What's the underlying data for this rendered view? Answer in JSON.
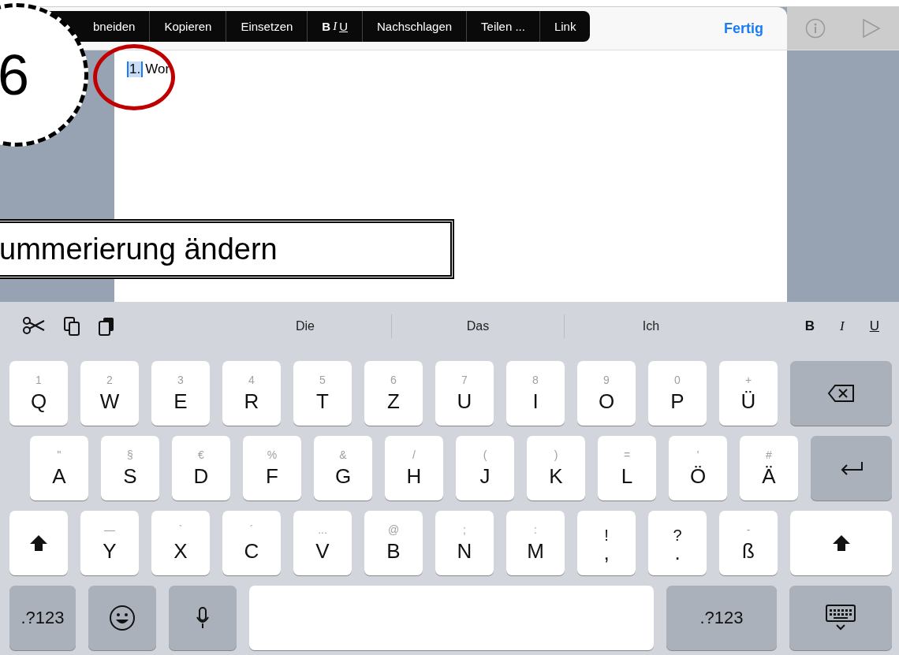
{
  "edit_menu": {
    "items": [
      {
        "kind": "text",
        "label": "bneiden"
      },
      {
        "kind": "text",
        "label": "Kopieren"
      },
      {
        "kind": "text",
        "label": "Einsetzen"
      },
      {
        "kind": "format",
        "letters": [
          "B",
          "I",
          "U"
        ]
      },
      {
        "kind": "text",
        "label": "Nachschlagen"
      },
      {
        "kind": "text",
        "label": "Teilen ..."
      },
      {
        "kind": "text",
        "label": "Link"
      }
    ]
  },
  "toolbar": {
    "done": "Fertig"
  },
  "document": {
    "number": "1.",
    "text": "Wor"
  },
  "annotations": {
    "step": "6",
    "caption": "ummerierung ändern"
  },
  "keyboard": {
    "shortcuts": [
      {
        "kind": "cut"
      },
      {
        "kind": "copy"
      },
      {
        "kind": "paste"
      }
    ],
    "suggestions": [
      "Die",
      "Das",
      "Ich"
    ],
    "format": [
      {
        "kind": "bold",
        "label": "B"
      },
      {
        "kind": "italic",
        "label": "I"
      },
      {
        "kind": "underline",
        "label": "U"
      }
    ],
    "rows": [
      [
        {
          "kind": "char",
          "label": "Q",
          "hint": "1"
        },
        {
          "kind": "char",
          "label": "W",
          "hint": "2"
        },
        {
          "kind": "char",
          "label": "E",
          "hint": "3"
        },
        {
          "kind": "char",
          "label": "R",
          "hint": "4"
        },
        {
          "kind": "char",
          "label": "T",
          "hint": "5"
        },
        {
          "kind": "char",
          "label": "Z",
          "hint": "6"
        },
        {
          "kind": "char",
          "label": "U",
          "hint": "7"
        },
        {
          "kind": "char",
          "label": "I",
          "hint": "8"
        },
        {
          "kind": "char",
          "label": "O",
          "hint": "9"
        },
        {
          "kind": "char",
          "label": "P",
          "hint": "0"
        },
        {
          "kind": "char",
          "label": "Ü",
          "hint": "+"
        },
        {
          "kind": "backspace"
        }
      ],
      [
        {
          "kind": "char",
          "label": "A",
          "hint": "\""
        },
        {
          "kind": "char",
          "label": "S",
          "hint": "§"
        },
        {
          "kind": "char",
          "label": "D",
          "hint": "€"
        },
        {
          "kind": "char",
          "label": "F",
          "hint": "%"
        },
        {
          "kind": "char",
          "label": "G",
          "hint": "&"
        },
        {
          "kind": "char",
          "label": "H",
          "hint": "/"
        },
        {
          "kind": "char",
          "label": "J",
          "hint": "("
        },
        {
          "kind": "char",
          "label": "K",
          "hint": ")"
        },
        {
          "kind": "char",
          "label": "L",
          "hint": "="
        },
        {
          "kind": "char",
          "label": "Ö",
          "hint": "'"
        },
        {
          "kind": "char",
          "label": "Ä",
          "hint": "#"
        },
        {
          "kind": "return"
        }
      ],
      [
        {
          "kind": "shift"
        },
        {
          "kind": "char",
          "label": "Y",
          "hint": "—"
        },
        {
          "kind": "char",
          "label": "X",
          "hint": "`"
        },
        {
          "kind": "char",
          "label": "C",
          "hint": "´"
        },
        {
          "kind": "char",
          "label": "V",
          "hint": "..."
        },
        {
          "kind": "char",
          "label": "B",
          "hint": "@"
        },
        {
          "kind": "char",
          "label": "N",
          "hint": ";"
        },
        {
          "kind": "char",
          "label": "M",
          "hint": ":"
        },
        {
          "kind": "punct",
          "top": "!",
          "label": ","
        },
        {
          "kind": "punct",
          "top": "?",
          "label": "."
        },
        {
          "kind": "char",
          "label": "ß",
          "hint": "-"
        },
        {
          "kind": "shift"
        }
      ],
      [
        {
          "kind": "mode",
          "label": ".?123"
        },
        {
          "kind": "emoji"
        },
        {
          "kind": "mic"
        },
        {
          "kind": "space"
        },
        {
          "kind": "mode",
          "label": ".?123"
        },
        {
          "kind": "hide"
        }
      ]
    ]
  }
}
